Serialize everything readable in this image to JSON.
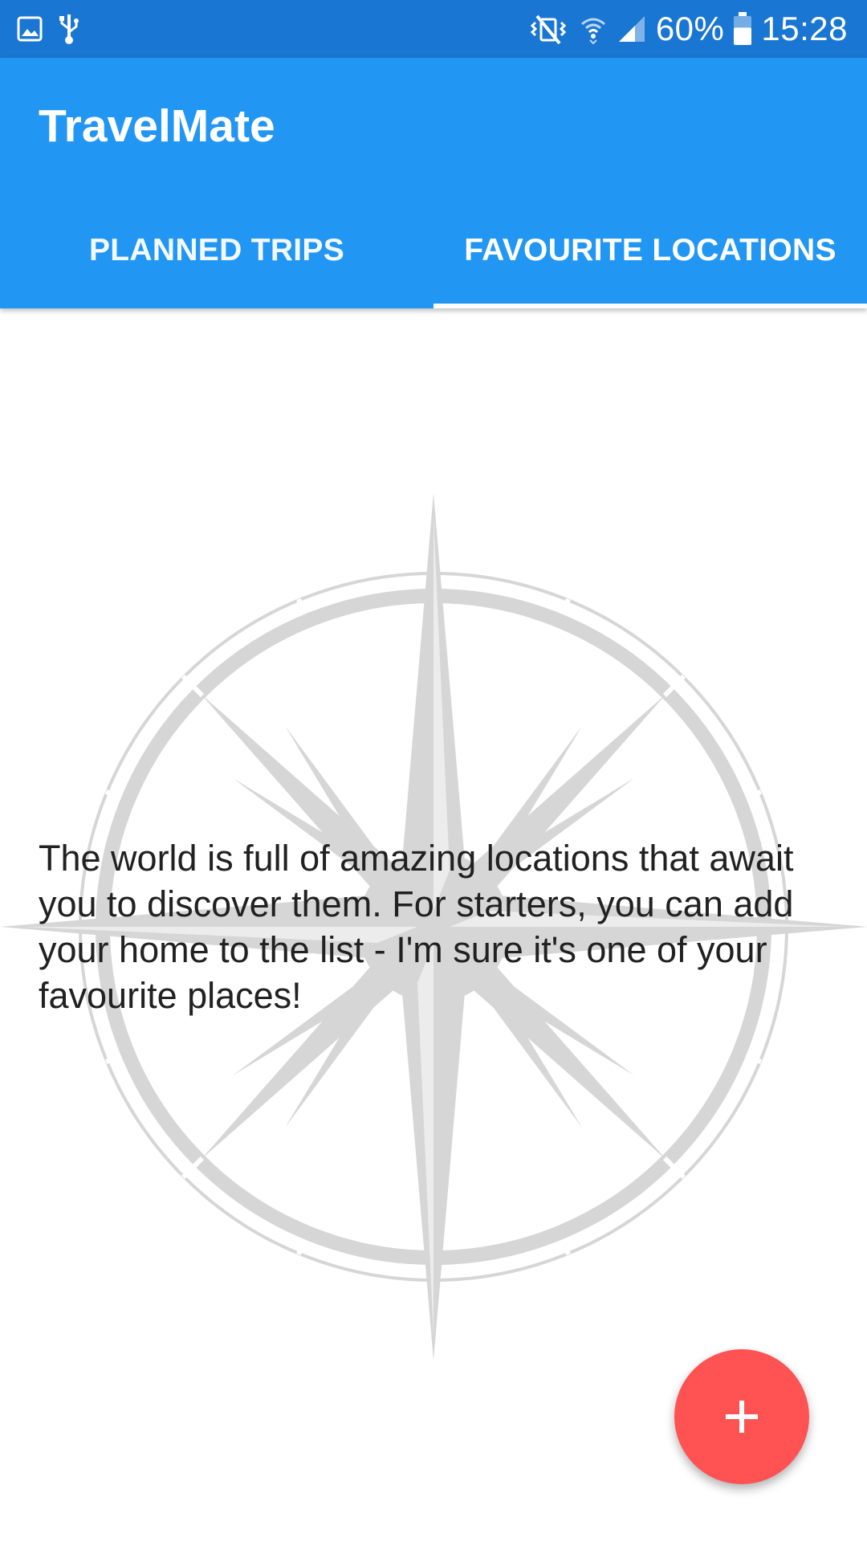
{
  "status_bar": {
    "left_icons": [
      "gallery-notification-icon",
      "usb-debug-icon"
    ],
    "right_icons": [
      "mute-vibrate-icon",
      "wifi-icon",
      "cell-signal-icon",
      "battery-icon"
    ],
    "battery_percent": "60%",
    "battery_level": 0.6,
    "time": "15:28",
    "background": "#1976D2"
  },
  "app_bar": {
    "title": "TravelMate",
    "background": "#2196F3",
    "tabs": [
      {
        "label": "PLANNED TRIPS",
        "selected": false
      },
      {
        "label": "FAVOURITE LOCATIONS",
        "selected": true
      }
    ]
  },
  "content": {
    "background_icon": "compass-rose-icon",
    "empty_message": "The world is full of amazing locations that await you to discover them. For starters, you can add your home to the list - I'm sure it's one of your favourite places!"
  },
  "fab": {
    "icon": "plus-icon",
    "color": "#FF5252"
  }
}
